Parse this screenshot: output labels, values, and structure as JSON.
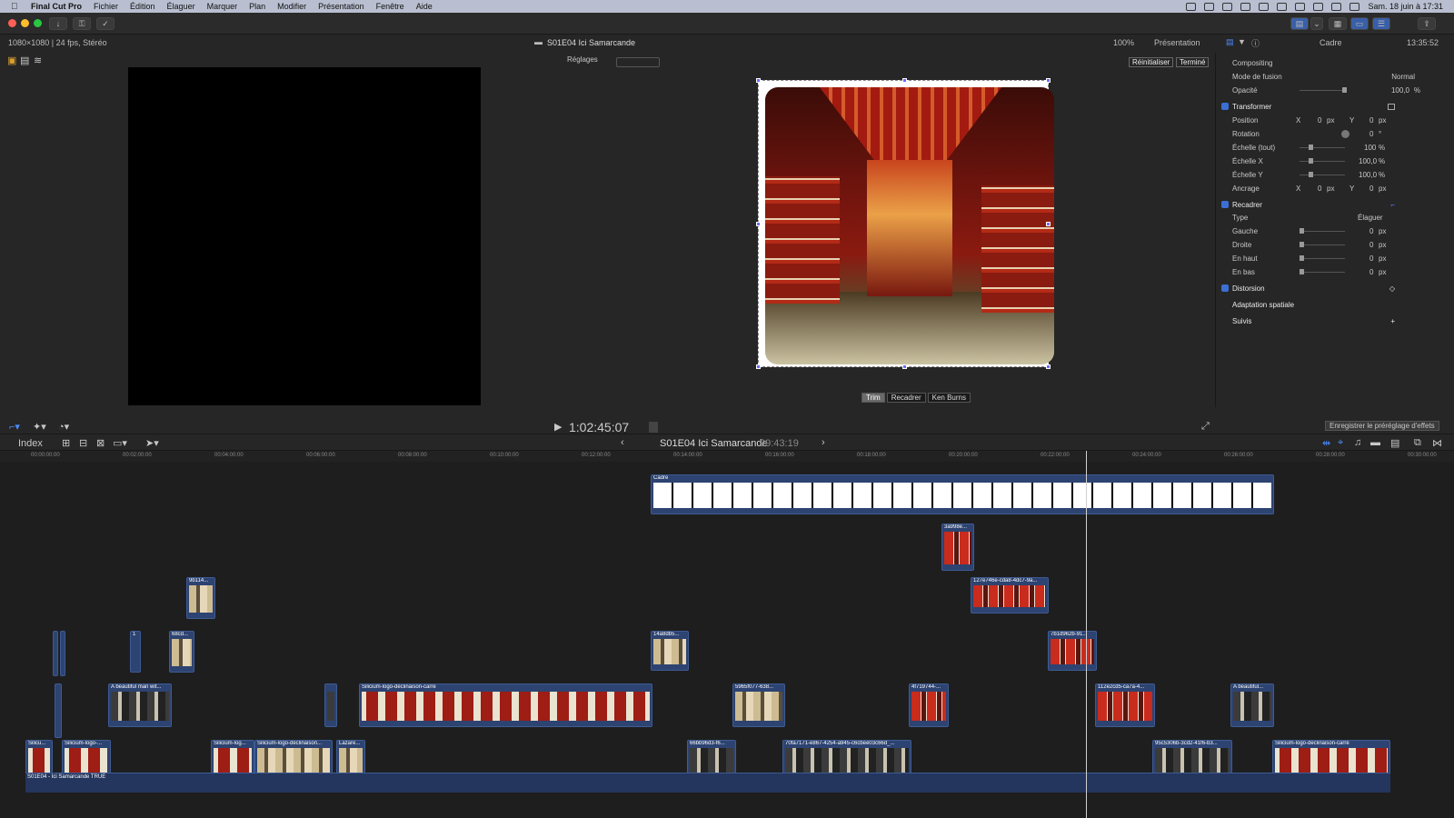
{
  "menubar": {
    "app": "Final Cut Pro",
    "items": [
      "Fichier",
      "Édition",
      "Élaguer",
      "Marquer",
      "Plan",
      "Modifier",
      "Présentation",
      "Fenêtre",
      "Aide"
    ],
    "clock": "Sam. 18 juin à 17:31"
  },
  "infobar": {
    "format": "1080×1080 | 24 fps, Stéréo",
    "project_title": "S01E04 Ici Samarcande",
    "zoom": "100%",
    "presentation": "Présentation",
    "settings": "Réglages"
  },
  "viewer": {
    "reset": "Réinitialiser",
    "done": "Terminé",
    "modes": [
      "Trim",
      "Recadrer",
      "Ken Burns"
    ],
    "timecode": "1:02:45:07"
  },
  "inspector": {
    "tab_title": "Cadre",
    "duration": "13:35:52",
    "compositing": "Compositing",
    "blend_label": "Mode de fusion",
    "blend_value": "Normal",
    "opacity_label": "Opacité",
    "opacity_value": "100,0",
    "opacity_unit": "%",
    "transform": "Transformer",
    "position_label": "Position",
    "position_x": "0",
    "position_y": "0",
    "rotation_label": "Rotation",
    "rotation_value": "0",
    "scale_all_label": "Échelle (tout)",
    "scale_all_value": "100",
    "scale_x_label": "Échelle X",
    "scale_x_value": "100,0",
    "scale_y_label": "Échelle Y",
    "scale_y_value": "100,0",
    "anchor_label": "Ancrage",
    "anchor_x": "0",
    "anchor_y": "0",
    "crop": "Recadrer",
    "type_label": "Type",
    "type_value": "Élaguer",
    "left_label": "Gauche",
    "right_label": "Droite",
    "top_label": "En haut",
    "bottom_label": "En bas",
    "crop_value": "0",
    "distortion": "Distorsion",
    "spatial": "Adaptation spatiale",
    "tracking": "Suivis",
    "save_preset": "Enregistrer le préréglage d'effets",
    "px": "px",
    "pct": "%",
    "deg": "°",
    "x": "X",
    "y": "Y"
  },
  "timeline": {
    "index": "Index",
    "project": "S01E04 Ici Samarcande",
    "duration": "29:43:19",
    "ruler": [
      "00:00:00:00",
      "00:02:00:00",
      "00:04:00:00",
      "00:06:00:00",
      "00:08:00:00",
      "00:10:00:00",
      "00:12:00:00",
      "00:14:00:00",
      "00:16:00:00",
      "00:18:00:00",
      "00:20:00:00",
      "00:22:00:00",
      "00:24:00:00",
      "00:26:00:00",
      "00:28:00:00",
      "00:30:00:00"
    ],
    "main_story": "S01E04 - Ici Samarcande TRUE",
    "clips": {
      "cadre": "Cadre",
      "c1": "3a998e...",
      "c2": "127e746e-cda8-4dc7-9a...",
      "c3": "9b114...",
      "c4": "68cd...",
      "c5": "7b1d962b-91...",
      "c6": "14a8db5...",
      "c7": "A beautiful man wit...",
      "c8": "Silicium-logo-déclinaison-carré",
      "c9": "5965f077-638...",
      "c10": "4f719744-...",
      "c11": "112e2cd5-ca7a-4...",
      "c12": "A beautiful...",
      "c13": "Silicu...",
      "c14": "Silicium-logo-...",
      "c15": "Silicium-log...",
      "c16": "Silicium-logo-déclinaison...",
      "c17": "Lazare...",
      "c18": "66bb96d3-f6...",
      "c19": "70fa7171-e867-4254-a945-c6cbee03c66d_...",
      "c20": "95c5306b-3cd2-41f6-b3...",
      "c21": "Silicium-logo-déclinaison-carré",
      "c22": "1"
    }
  }
}
